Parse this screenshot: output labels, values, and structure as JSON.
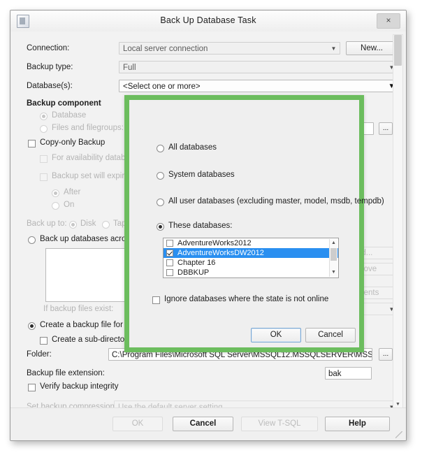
{
  "window": {
    "title": "Back Up Database Task",
    "close_label": "×",
    "icon": "database-task-icon"
  },
  "form": {
    "connection_label": "Connection:",
    "connection_value": "Local server connection",
    "new_button": "New...",
    "backup_type_label": "Backup type:",
    "backup_type_value": "Full",
    "databases_label": "Database(s):",
    "databases_value": "<Select one or more>",
    "backup_component_label": "Backup component",
    "database_radio": "Database",
    "files_filegroups_radio": "Files and filegroups:",
    "copy_only_backup": "Copy-only Backup",
    "availability_databases": "For availability databases, i",
    "backup_set_expire": "Backup set will expire:",
    "after_radio": "After",
    "on_radio": "On",
    "back_up_to_label": "Back up to:",
    "disk_radio": "Disk",
    "tape_radio": "Tape",
    "across_radio": "Back up databases across o",
    "add_button": "dd...",
    "remove_button": "move",
    "contents_button": "ntents",
    "if_backup_exists_label": "If backup files exist:",
    "create_file_radio": "Create a backup file for eve",
    "create_subdir_check": "Create a sub-directory f",
    "folder_label": "Folder:",
    "folder_value": "C:\\Program Files\\Microsoft SQL Server\\MSSQL12.MSSQLSERVER\\MSSQL\\Backup",
    "ellipsis_button": "...",
    "extension_label": "Backup file extension:",
    "extension_value": "bak",
    "verify_integrity": "Verify backup integrity",
    "compression_label": "Set backup compression:",
    "compression_value": "Use the default server setting"
  },
  "footer": {
    "ok": "OK",
    "cancel": "Cancel",
    "view_tsql": "View T-SQL",
    "help": "Help"
  },
  "popup": {
    "all_databases": "All databases",
    "system_databases": "System databases",
    "all_user_databases": "All user databases  (excluding master, model, msdb, tempdb)",
    "these_databases": "These databases:",
    "ignore_offline": "Ignore databases where the state is not online",
    "ok": "OK",
    "cancel": "Cancel",
    "db_list": [
      {
        "name": "AdventureWorks2012",
        "checked": false,
        "selected": false
      },
      {
        "name": "AdventureWorksDW2012",
        "checked": true,
        "selected": true
      },
      {
        "name": "Chapter 16",
        "checked": false,
        "selected": false
      },
      {
        "name": "DBBKUP",
        "checked": false,
        "selected": false
      }
    ],
    "scroll_up": "▲",
    "scroll_down": "▼"
  },
  "colors": {
    "highlight_green": "#6cbd5e",
    "selection_blue": "#2a8ff0"
  },
  "glyphs": {
    "chevron_down": "❯",
    "arrow_down_solid": "▼",
    "arrow_up": "▲"
  }
}
